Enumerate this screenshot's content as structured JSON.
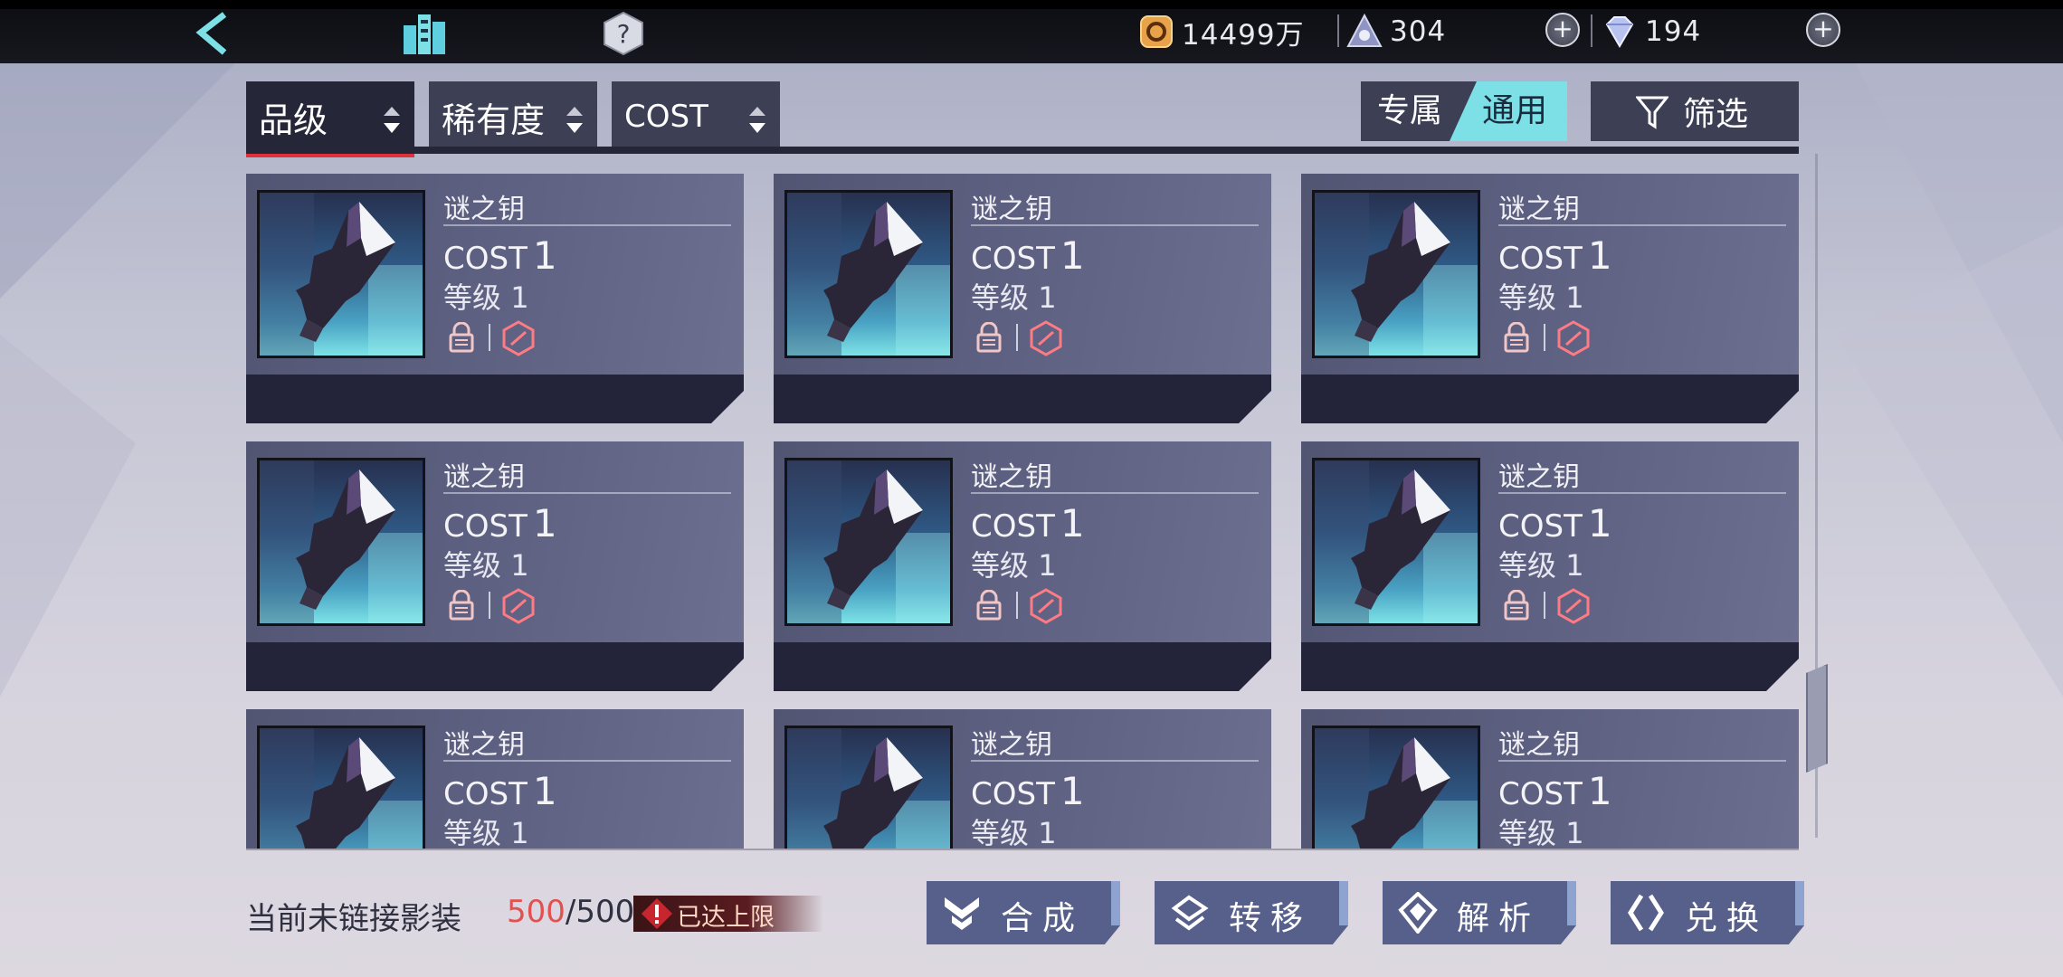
{
  "resources": {
    "coins": "14499万",
    "stamina": "304",
    "gems": "194"
  },
  "sort": {
    "tabs": [
      "品级",
      "稀有度",
      "COST"
    ],
    "active_index": 0
  },
  "toggle": {
    "option_a": "专属",
    "option_b": "通用",
    "selected": "通用"
  },
  "filter_label": "筛选",
  "cards": [
    {
      "name": "谜之钥",
      "cost_label": "COST",
      "cost": "1",
      "level_label": "等级",
      "level": "1"
    },
    {
      "name": "谜之钥",
      "cost_label": "COST",
      "cost": "1",
      "level_label": "等级",
      "level": "1"
    },
    {
      "name": "谜之钥",
      "cost_label": "COST",
      "cost": "1",
      "level_label": "等级",
      "level": "1"
    },
    {
      "name": "谜之钥",
      "cost_label": "COST",
      "cost": "1",
      "level_label": "等级",
      "level": "1"
    },
    {
      "name": "谜之钥",
      "cost_label": "COST",
      "cost": "1",
      "level_label": "等级",
      "level": "1"
    },
    {
      "name": "谜之钥",
      "cost_label": "COST",
      "cost": "1",
      "level_label": "等级",
      "level": "1"
    },
    {
      "name": "谜之钥",
      "cost_label": "COST",
      "cost": "1",
      "level_label": "等级",
      "level": "1"
    },
    {
      "name": "谜之钥",
      "cost_label": "COST",
      "cost": "1",
      "level_label": "等级",
      "level": "1"
    },
    {
      "name": "谜之钥",
      "cost_label": "COST",
      "cost": "1",
      "level_label": "等级",
      "level": "1"
    }
  ],
  "bottom": {
    "label": "当前未链接影装",
    "current": "500",
    "max": "/500",
    "limit_text": "已达上限"
  },
  "actions": [
    "合成",
    "转移",
    "解析",
    "兑换"
  ],
  "colors": {
    "accent_cyan": "#7de0e6",
    "alert_red": "#e35050",
    "panel": "#525572"
  }
}
